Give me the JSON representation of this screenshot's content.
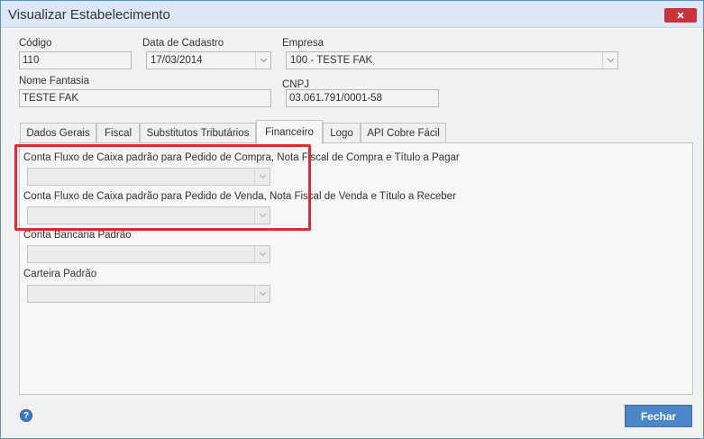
{
  "window": {
    "title": "Visualizar Estabelecimento"
  },
  "fields": {
    "codigo": {
      "label": "Código",
      "value": "110"
    },
    "data_cadastro": {
      "label": "Data de Cadastro",
      "value": "17/03/2014"
    },
    "empresa": {
      "label": "Empresa",
      "value": "100 - TESTE FAK"
    },
    "nome_fantasia": {
      "label": "Nome Fantasia",
      "value": "TESTE FAK"
    },
    "cnpj": {
      "label": "CNPJ",
      "value": "03.061.791/0001-58"
    }
  },
  "tabs": [
    {
      "label": "Dados Gerais"
    },
    {
      "label": "Fiscal"
    },
    {
      "label": "Substitutos Tributários"
    },
    {
      "label": "Financeiro"
    },
    {
      "label": "Logo"
    },
    {
      "label": "API Cobre Fácil"
    }
  ],
  "active_tab": "Financeiro",
  "financeiro": {
    "fluxo_compra": {
      "label": "Conta Fluxo de Caixa padrão para Pedido de Compra, Nota Fiscal de Compra e Título a Pagar",
      "value": ""
    },
    "fluxo_venda": {
      "label": "Conta Fluxo de Caixa padrão para Pedido de Venda, Nota Fiscal de Venda e Título a Receber",
      "value": ""
    },
    "conta_bancaria": {
      "label": "Conta Bancária Padrão",
      "value": ""
    },
    "carteira": {
      "label": "Carteira Padrão",
      "value": ""
    }
  },
  "footer": {
    "close_label": "Fechar",
    "help_icon_glyph": "?"
  },
  "colors": {
    "highlight": "#e02a32",
    "primary_button": "#4a86c8",
    "close_button": "#c9343c"
  }
}
